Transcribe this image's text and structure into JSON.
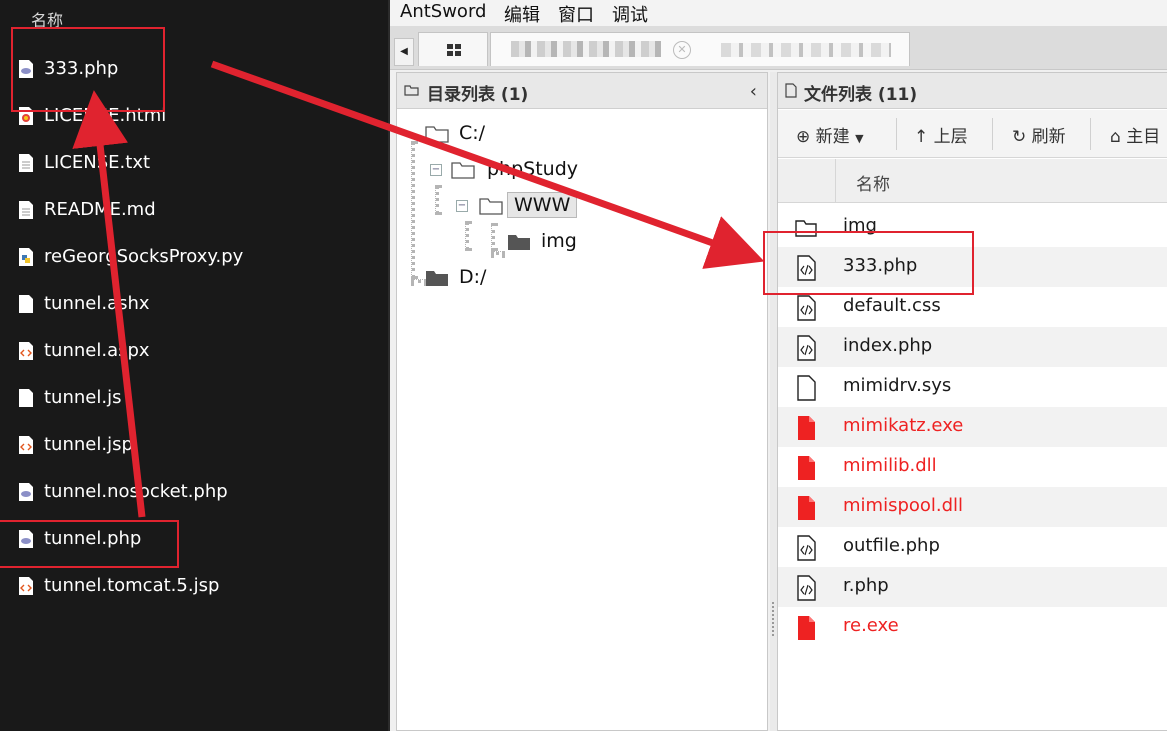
{
  "explorer": {
    "column_header": "名称",
    "files": [
      {
        "name": "333.php",
        "icon": "php-file-icon"
      },
      {
        "name": "LICENSE.html",
        "icon": "html-file-icon"
      },
      {
        "name": "LICENSE.txt",
        "icon": "text-file-icon"
      },
      {
        "name": "README.md",
        "icon": "text-file-icon"
      },
      {
        "name": "reGeorgSocksProxy.py",
        "icon": "python-file-icon"
      },
      {
        "name": "tunnel.ashx",
        "icon": "blank-file-icon"
      },
      {
        "name": "tunnel.aspx",
        "icon": "code-file-icon"
      },
      {
        "name": "tunnel.js",
        "icon": "blank-file-icon"
      },
      {
        "name": "tunnel.jsp",
        "icon": "code-file-icon"
      },
      {
        "name": "tunnel.nosocket.php",
        "icon": "php-file-icon"
      },
      {
        "name": "tunnel.php",
        "icon": "php-file-icon"
      },
      {
        "name": "tunnel.tomcat.5.jsp",
        "icon": "code-file-icon"
      }
    ]
  },
  "antsword": {
    "menu": [
      "AntSword",
      "编辑",
      "窗口",
      "调试"
    ],
    "dir_panel": {
      "title": "目录列表 (1)",
      "collapse_icon": "chevron-left-icon",
      "tree": [
        {
          "label": "C:/",
          "icon": "folder-open-icon"
        },
        {
          "label": "phpStudy",
          "icon": "folder-open-icon"
        },
        {
          "label": "WWW",
          "icon": "folder-open-icon"
        },
        {
          "label": "img",
          "icon": "folder-closed-icon"
        },
        {
          "label": "D:/",
          "icon": "folder-closed-icon"
        }
      ]
    },
    "file_panel": {
      "title": "文件列表 (11)",
      "toolbar": {
        "new": "新建",
        "up": "上层",
        "refresh": "刷新",
        "home": "主目"
      },
      "column_name": "名称",
      "files": [
        {
          "name": "img",
          "icon": "folder-icon",
          "highlight": false
        },
        {
          "name": "333.php",
          "icon": "code-file-icon",
          "highlight": false
        },
        {
          "name": "default.css",
          "icon": "code-file-icon",
          "highlight": false
        },
        {
          "name": "index.php",
          "icon": "code-file-icon",
          "highlight": false
        },
        {
          "name": "mimidrv.sys",
          "icon": "blank-file-icon",
          "highlight": false
        },
        {
          "name": "mimikatz.exe",
          "icon": "red-file-icon",
          "highlight": true
        },
        {
          "name": "mimilib.dll",
          "icon": "red-file-icon",
          "highlight": true
        },
        {
          "name": "mimispool.dll",
          "icon": "red-file-icon",
          "highlight": true
        },
        {
          "name": "outfile.php",
          "icon": "code-file-icon",
          "highlight": false
        },
        {
          "name": "r.php",
          "icon": "code-file-icon",
          "highlight": false
        },
        {
          "name": "re.exe",
          "icon": "red-file-icon",
          "highlight": true
        }
      ]
    }
  },
  "colors": {
    "annotation_red": "#e0232f",
    "danger_file_red": "#ee2222"
  }
}
